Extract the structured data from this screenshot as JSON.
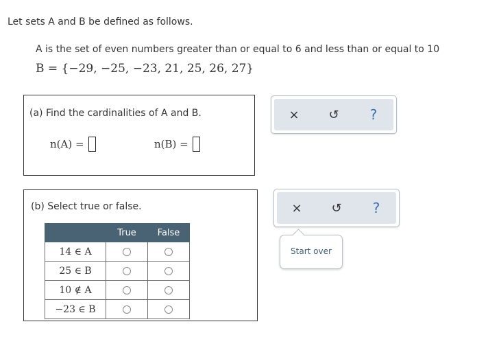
{
  "intro": "Let sets A and B be defined as follows.",
  "definitions": {
    "a_text": "A is the set of even numbers greater than or equal to 6 and less than or equal to 10",
    "b_text": "B = {−29, −25, −23, 21, 25, 26, 27}"
  },
  "part_a": {
    "title": "(a) Find the cardinalities of A and B.",
    "nA_label": "n(A) =",
    "nB_label": "n(B) =",
    "nA_value": "",
    "nB_value": ""
  },
  "part_b": {
    "title": "(b) Select true or false.",
    "headers": [
      "True",
      "False"
    ],
    "rows": [
      "14 ∈ A",
      "25 ∈ B",
      "10 ∉ A",
      "−23 ∈ B"
    ]
  },
  "toolbar": {
    "close": "×",
    "undo": "↺",
    "help": "?"
  },
  "popover": {
    "text": "Start over"
  }
}
